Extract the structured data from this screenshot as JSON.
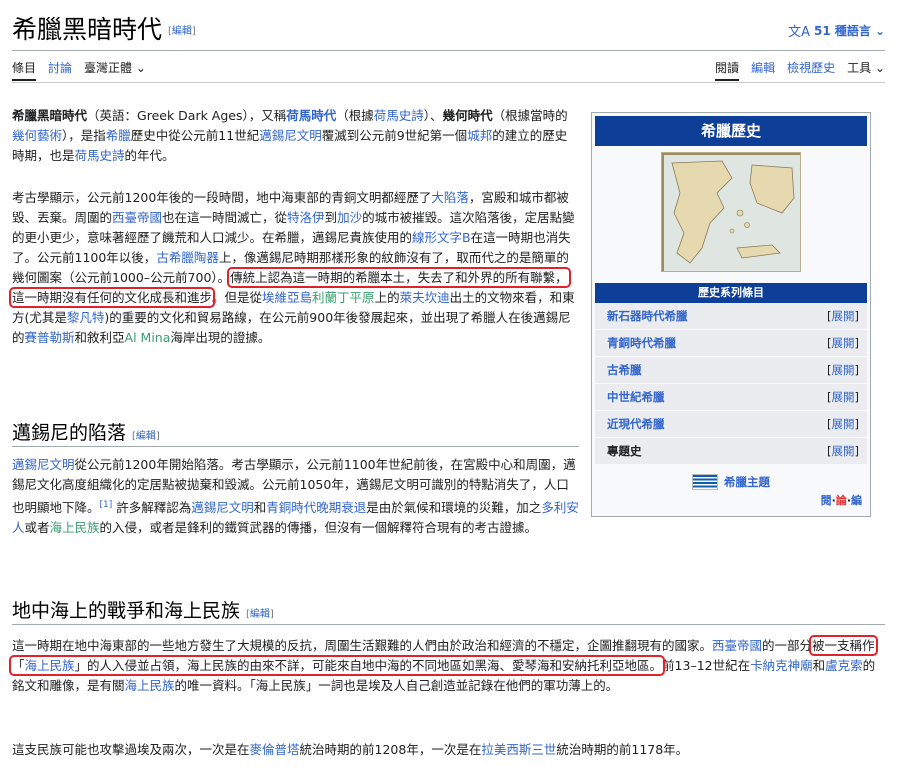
{
  "page": {
    "title": "希臘黑暗時代",
    "edit_label": "編輯",
    "lang_button": "51 種語言",
    "lang_glyph": "文A"
  },
  "tabs": {
    "left": [
      "條目",
      "討論",
      "臺灣正體"
    ],
    "right": [
      "閱讀",
      "編輯",
      "檢視歷史",
      "工具"
    ]
  },
  "sections": {
    "lead1": {
      "t1": "希臘黑暗時代",
      "t2": "（英語：Greek Dark Ages），又稱",
      "l1": "荷馬時代",
      "t3": "（根據",
      "l2": "荷馬史詩",
      "t4": "）、",
      "b1": "幾何時代",
      "t5": "（根據當時的",
      "l3": "幾何藝術",
      "t6": "），是指",
      "l4": "希臘",
      "t7": "歷史中從公元前11世紀",
      "l5": "邁錫尼文明",
      "t8": "覆滅到公元前9世紀第一個",
      "l6": "城邦",
      "t9": "的建立的歷史時期，也是",
      "l7": "荷馬史詩",
      "t10": "的年代。"
    },
    "lead2": {
      "t1": "考古學顯示，公元前1200年後的一段時間，地中海東部的青銅文明都經歷了",
      "l1": "大陷落",
      "t2": "，宮殿和城市都被毀、丟棄。周圍的",
      "l2": "西臺帝國",
      "t3": "也在這一時間滅亡，從",
      "l3": "特洛伊",
      "t4": "到",
      "l4": "加沙",
      "t5": "的城市被摧毀。這次陷落後，定居點變的更小更少，意味著經歷了饑荒和人口減少。在希臘，邁錫尼貴族使用的",
      "l5": "線形文字B",
      "t6": "在這一時期也消失了。公元前1100年以後，",
      "l6": "古希臘陶器",
      "t7": "上，像邁錫尼時期那樣形象的紋飾沒有了，取而代之的是簡單的幾何圖案（公元前1000–公元前700）。",
      "hl": "傳統上認為這一時期的希臘本土，失去了和外界的所有聯繫，這一時期沒有任何的文化成長和進步",
      "t8": "。但是從",
      "l7": "埃維亞島",
      "l8": "利蘭丁平原",
      "t9": "上的",
      "l9": "萊夫坎迪",
      "t10": "出土的文物來看，和東方(尤其是",
      "l10": "黎凡特",
      "t11": ")的重要的文化和貿易路線，在公元前900年後發展起來，並出現了希臘人在後邁錫尼的",
      "l11": "賽普勒斯",
      "t12": "和敘利亞",
      "l12": "Al Mina",
      "t13": "海岸出現的證據。"
    },
    "s1": {
      "heading": "邁錫尼的陷落",
      "l1": "邁錫尼文明",
      "t1": "從公元前1200年開始陷落。考古學顯示，公元前1100年世紀前後，在宮殿中心和周圍，邁錫尼文化高度組織化的定居點被拋棄和毀滅。公元前1050年，邁錫尼文明可識別的特點消失了，人口也明顯地下降。",
      "ref": "[1]",
      "t2": " 許多解釋認為",
      "l2": "邁錫尼文明",
      "t3": "和",
      "l3": "青銅時代晚期衰退",
      "t4": "是由於氣候和環境的災難，加之",
      "l4": "多利安人",
      "t5": "或者",
      "l5": "海上民族",
      "t6": "的入侵，或者是鋒利的鐵質武器的傳播，但沒有一個解釋符合現有的考古證據。"
    },
    "s2": {
      "heading": "地中海上的戰爭和海上民族",
      "t1": "這一時期在地中海東部的一些地方發生了大規模的反抗，周圍生活艱難的人們由於政治和經濟的不穩定，企圖推翻現有的國家。",
      "l1": "西臺帝國",
      "t2": "的一部分",
      "hl1": "被一支稱作「",
      "hl_link": "海上民族",
      "hl2": "」的人入侵並占領，海上民族的由來不詳，可能來自地中海的不同地區如黑海、愛琴海和安納托利亞地區。",
      "t3": "前13–12世紀在",
      "l2": "卡納克神廟",
      "t4": "和",
      "l3": "盧克索",
      "t5": "的銘文和雕像，是有關",
      "l4": "海上民族",
      "t6": "的唯一資料。「海上民族」一詞也是埃及人自己創造並記錄在他們的軍功薄上的。",
      "p2_t1": "這支民族可能也攻擊過埃及兩次，一次是在",
      "p2_l1": "麥倫普塔",
      "p2_t2": "統治時期的前1208年，一次是在",
      "p2_l2": "拉美西斯三世",
      "p2_t3": "統治時期的前1178年。"
    }
  },
  "infobox": {
    "title": "希臘歷史",
    "subheader": "歷史系列條目",
    "rows": [
      {
        "label": "新石器時代希臘",
        "expand": "展開"
      },
      {
        "label": "青銅時代希臘",
        "expand": "展開"
      },
      {
        "label": "古希臘",
        "expand": "展開"
      },
      {
        "label": "中世紀希臘",
        "expand": "展開"
      },
      {
        "label": "近現代希臘",
        "expand": "展開"
      },
      {
        "label": "專題史",
        "expand": "展開"
      }
    ],
    "portal": "希臘主題",
    "vte": [
      "閱",
      "論",
      "編"
    ],
    "colors": {
      "header": "#0d3e98",
      "row_bg": "#eaecf0"
    }
  }
}
